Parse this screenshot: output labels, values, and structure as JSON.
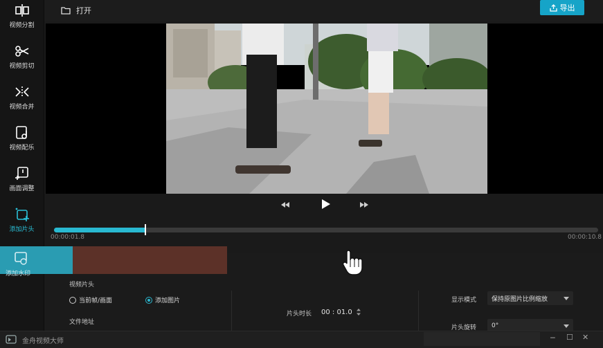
{
  "sidebar": {
    "items": [
      {
        "label": "视频分割",
        "icon": "video-split-icon"
      },
      {
        "label": "视频剪切",
        "icon": "scissors-icon"
      },
      {
        "label": "视频合并",
        "icon": "video-merge-icon"
      },
      {
        "label": "视频配乐",
        "icon": "music-file-icon"
      },
      {
        "label": "画面调整",
        "icon": "frame-adjust-icon"
      },
      {
        "label": "添加片头",
        "icon": "add-intro-icon"
      },
      {
        "label": "添加水印",
        "icon": "watermark-icon"
      }
    ],
    "active_index": 5
  },
  "toolbar": {
    "open_label": "打开",
    "export_label": "导出"
  },
  "player": {
    "current_time": "00:00:01.8",
    "total_time": "00:00:10.8",
    "progress": 0.1667
  },
  "properties": {
    "section_title": "视频片头",
    "radio_current": "当前帧/画面",
    "radio_image": "添加图片",
    "file_address_label": "文件地址",
    "duration_label": "片头时长",
    "duration_value": "00 : 01.0",
    "display_mode_label": "显示模式",
    "display_mode_value": "保持原图片比例缩放",
    "rotate_label": "片头旋转",
    "rotate_value": "0°"
  },
  "taskbar": {
    "app_name": "金舟视频大师"
  },
  "colors": {
    "accent": "#29b9d1",
    "export_button": "#16a4c8",
    "clip": "#5c3128"
  }
}
